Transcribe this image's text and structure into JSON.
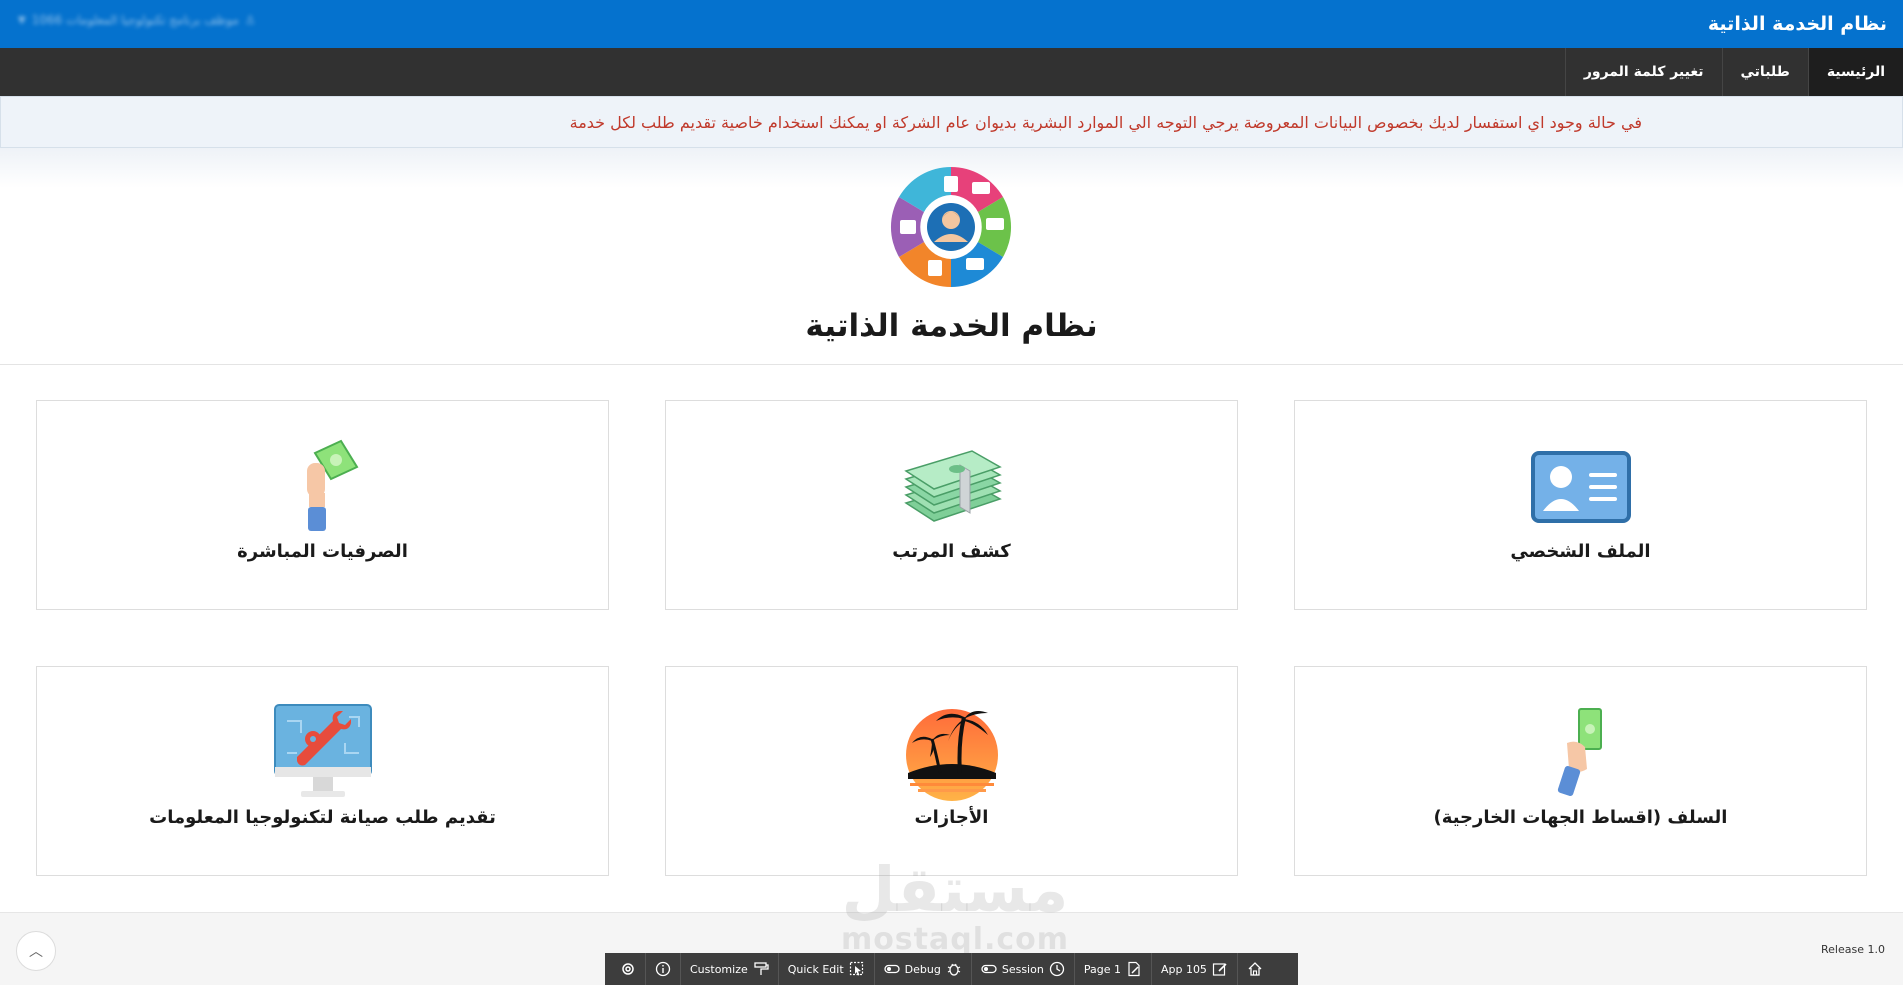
{
  "header": {
    "app_title": "نظام الخدمة الذاتية",
    "user_menu_label": "موظف برنامج تكنولوجيا المعلومات 1066"
  },
  "nav": {
    "items": [
      {
        "label": "الرئيسية",
        "active": true
      },
      {
        "label": "طلباتي",
        "active": false
      },
      {
        "label": "تغيير كلمة المرور",
        "active": false
      }
    ]
  },
  "alert": {
    "text": "في حالة وجود اي استفسار لديك بخصوص البيانات المعروضة يرجي التوجه الي الموارد البشرية بديوان عام الشركة او يمكنك استخدام خاصية تقديم طلب لكل خدمة"
  },
  "hero": {
    "title": "نظام الخدمة الذاتية"
  },
  "cards": [
    {
      "label": "الملف الشخصي",
      "icon": "id-card-icon"
    },
    {
      "label": "كشف المرتب",
      "icon": "money-stack-icon"
    },
    {
      "label": "الصرفيات المباشرة",
      "icon": "hand-money-icon"
    },
    {
      "label": "السلف (اقساط الجهات الخارجية)",
      "icon": "hand-cash-icon"
    },
    {
      "label": "الأجازات",
      "icon": "palm-sunset-icon"
    },
    {
      "label": "تقديم طلب صيانة لتكنولوجيا المعلومات",
      "icon": "monitor-wrench-icon"
    }
  ],
  "footer": {
    "release": "Release 1.0"
  },
  "watermark": {
    "arabic": "مستقل",
    "latin": "mostaql.com"
  },
  "devbar": {
    "customize": "Customize",
    "quick_edit": "Quick Edit",
    "debug": "Debug",
    "session": "Session",
    "page": "Page 1",
    "app": "App 105"
  },
  "colors": {
    "header_bg": "#0572ce",
    "nav_bg": "#313131",
    "alert_text": "#c0392b"
  }
}
